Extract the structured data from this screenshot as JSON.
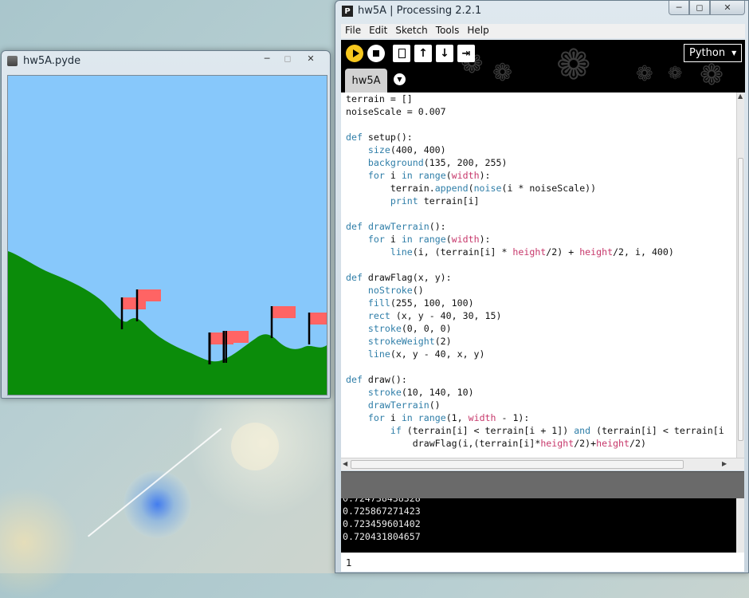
{
  "sketch_window": {
    "title": "hw5A.pyde",
    "sky_color": "#87c8fb",
    "terrain_color": "#0b8c0a",
    "flag_color": "#ff6464"
  },
  "ide_window": {
    "title": "hw5A | Processing 2.2.1",
    "menu": [
      "File",
      "Edit",
      "Sketch",
      "Tools",
      "Help"
    ],
    "mode_label": "Python",
    "tab_label": "hw5A",
    "code_lines": [
      "terrain = []",
      "noiseScale = 0.007",
      "",
      "def setup():",
      "    size(400, 400)",
      "    background(135, 200, 255)",
      "    for i in range(width):",
      "        terrain.append(noise(i * noiseScale))",
      "        print terrain[i]",
      "",
      "def drawTerrain():",
      "    for i in range(width):",
      "        line(i, (terrain[i] * height/2) + height/2, i, 400)",
      "",
      "def drawFlag(x, y):",
      "    noStroke()",
      "    fill(255, 100, 100)",
      "    rect (x, y - 40, 30, 15)",
      "    stroke(0, 0, 0)",
      "    strokeWeight(2)",
      "    line(x, y - 40, x, y)",
      "",
      "def draw():",
      "    stroke(10, 140, 10)",
      "    drawTerrain()",
      "    for i in range(1, width - 1):",
      "        if (terrain[i] < terrain[i + 1]) and (terrain[i] < terrain[i",
      "            drawFlag(i,(terrain[i]*height/2)+height/2)"
    ],
    "console_lines": [
      "0.724738438328",
      "0.725867271423",
      "0.723459601402",
      "0.720431804657"
    ],
    "line_number": "1"
  },
  "icons": {
    "run": "play-icon",
    "stop": "stop-icon",
    "new": "new-file-icon",
    "open": "open-icon",
    "save": "save-icon",
    "export": "export-icon"
  }
}
